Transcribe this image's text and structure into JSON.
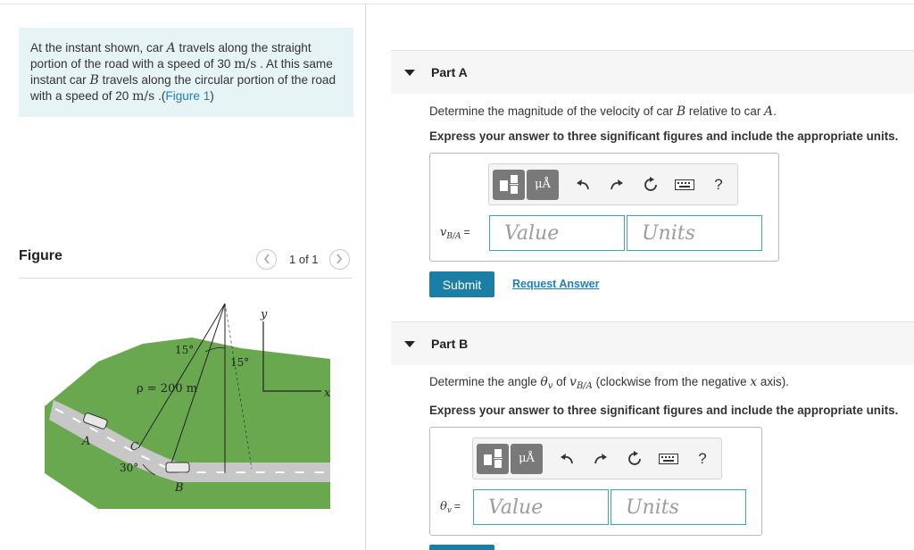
{
  "problem": {
    "text_1": "At the instant shown, car ",
    "var_a": "A",
    "text_2": " travels along the straight portion of the road with a speed of 30 ",
    "unit_1": "m/s",
    "text_3": " . At this same instant car ",
    "var_b": "B",
    "text_4": " travels along the circular portion of the road with a speed of 20 ",
    "unit_2": "m/s",
    "text_5": " .(",
    "figure_link": "Figure 1",
    "text_6": ")"
  },
  "figure": {
    "heading": "Figure",
    "pager_text": "1 of 1",
    "labels": {
      "y": "y",
      "x": "x",
      "angle_left": "15°",
      "angle_right": "15°",
      "radius": "ρ = 200 m",
      "angle_30": "30°",
      "car_a": "A",
      "car_b": "B",
      "center": "C"
    }
  },
  "part_a": {
    "title": "Part A",
    "question_1": "Determine the magnitude of the velocity of car ",
    "question_var1": "B",
    "question_2": " relative to car ",
    "question_var2": "A",
    "question_3": ".",
    "instruction": "Express your answer to three significant figures and include the appropriate units.",
    "var_main": "v",
    "var_sub": "B/A",
    "equals": "=",
    "value_placeholder": "Value",
    "units_placeholder": "Units",
    "submit_label": "Submit",
    "request_label": "Request Answer"
  },
  "part_b": {
    "title": "Part B",
    "question_1": "Determine the angle ",
    "theta": "θ",
    "theta_sub": "v",
    "question_2": " of ",
    "v": "v",
    "v_sub": "B/A",
    "question_3": " (clockwise from the negative ",
    "x": "x",
    "question_4": " axis).",
    "instruction": "Express your answer to three significant figures and include the appropriate units.",
    "var_main": "θ",
    "var_sub": "v",
    "equals": "=",
    "value_placeholder": "Value",
    "units_placeholder": "Units"
  },
  "toolbar": {
    "units_button": "μÅ",
    "help": "?"
  }
}
